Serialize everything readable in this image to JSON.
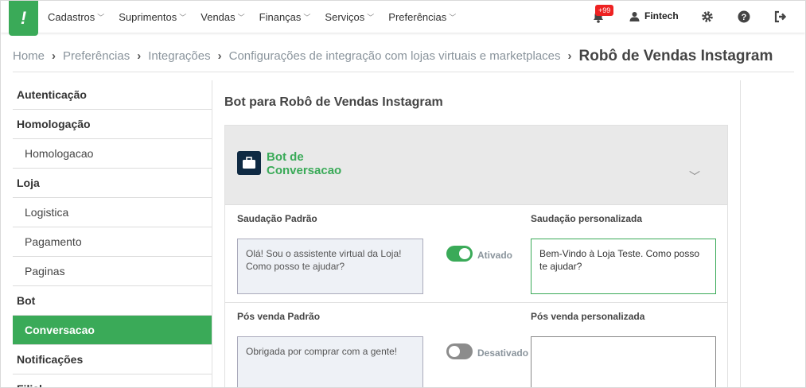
{
  "topbar": {
    "logo": "!",
    "menu": [
      {
        "label": "Cadastros"
      },
      {
        "label": "Suprimentos"
      },
      {
        "label": "Vendas"
      },
      {
        "label": "Finanças"
      },
      {
        "label": "Serviços"
      },
      {
        "label": "Preferências"
      }
    ],
    "notifications_badge": "+99",
    "user_name": "Fintech",
    "icons": [
      "bell-icon",
      "user-icon",
      "gear-icon",
      "help-icon",
      "logout-icon"
    ]
  },
  "breadcrumb": {
    "items": [
      "Home",
      "Preferências",
      "Integrações",
      "Configurações de integração com lojas virtuais e marketplaces"
    ],
    "current": "Robô de Vendas Instagram"
  },
  "sidebar": {
    "items": [
      {
        "label": "Autenticação",
        "type": "group"
      },
      {
        "label": "Homologação",
        "type": "group"
      },
      {
        "label": "Homologacao",
        "type": "sub"
      },
      {
        "label": "Loja",
        "type": "group"
      },
      {
        "label": "Logistica",
        "type": "sub"
      },
      {
        "label": "Pagamento",
        "type": "sub"
      },
      {
        "label": "Paginas",
        "type": "sub"
      },
      {
        "label": "Bot",
        "type": "group"
      },
      {
        "label": "Conversacao",
        "type": "sub",
        "active": true
      },
      {
        "label": "Notificações",
        "type": "group"
      },
      {
        "label": "Filial",
        "type": "group"
      }
    ]
  },
  "main": {
    "title": "Bot para Robô de Vendas Instagram",
    "panel_title": "Bot de Conversacao",
    "rows": [
      {
        "default_label": "Saudação Padrão",
        "default_text": "Olá! Sou o assistente virtual da Loja! Como posso te ajudar?",
        "toggle_state": "on",
        "toggle_label": "Ativado",
        "custom_label": "Saudação personalizada",
        "custom_text": "Bem-Vindo à Loja Teste. Como posso te ajudar?"
      },
      {
        "default_label": "Pós venda Padrão",
        "default_text": "Obrigada por comprar com a gente!",
        "toggle_state": "off",
        "toggle_label": "Desativado",
        "custom_label": "Pós venda personalizada",
        "custom_text": ""
      }
    ]
  },
  "colors": {
    "accent": "#3aaa58",
    "icon_dark": "#0f2a43",
    "badge": "#ee2222"
  }
}
